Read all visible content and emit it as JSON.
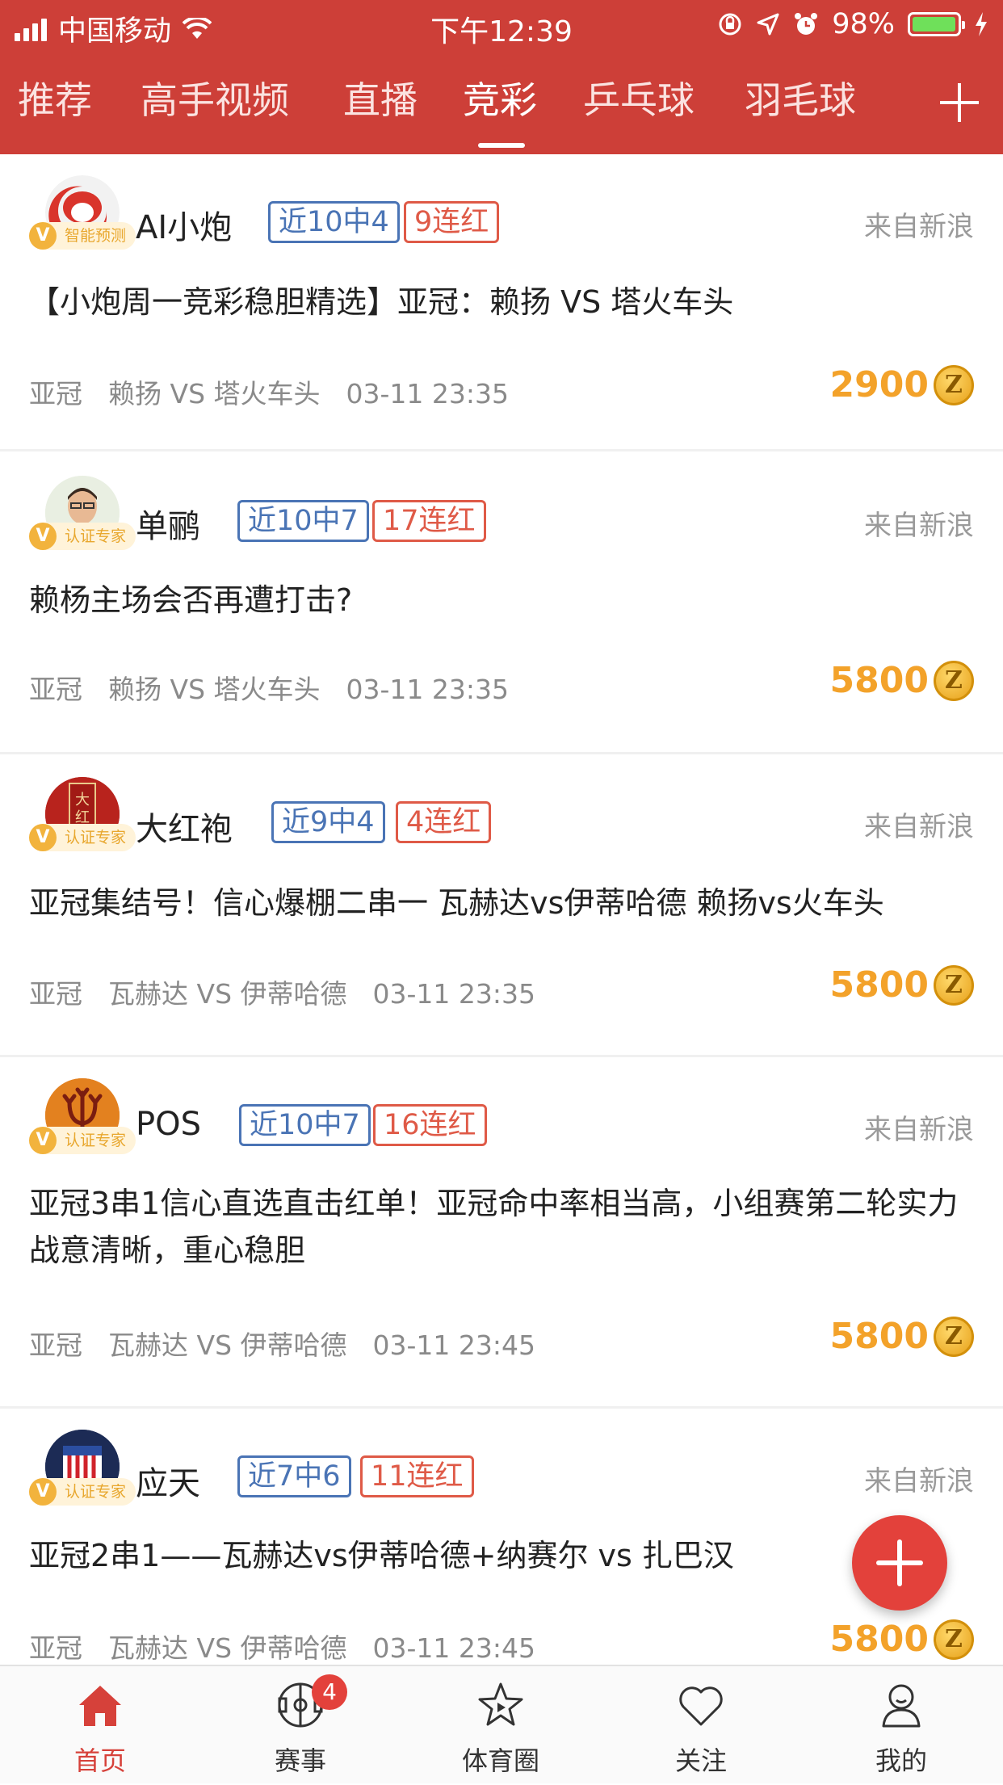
{
  "status_bar": {
    "carrier": "中国移动",
    "time": "下午12:39",
    "battery": "98%",
    "battery_level": 0.98
  },
  "nav_tabs": [
    {
      "label": "推荐",
      "active": false
    },
    {
      "label": "高手视频",
      "active": false
    },
    {
      "label": "直播",
      "active": false
    },
    {
      "label": "竞彩",
      "active": true
    },
    {
      "label": "乒乓球",
      "active": false
    },
    {
      "label": "羽毛球",
      "active": false
    }
  ],
  "posts": [
    {
      "author": "AI小炮",
      "badge": "智能预测",
      "record": "近10中4",
      "streak": "9连红",
      "source": "来自新浪",
      "title": "【小炮周一竞彩稳胆精选】亚冠：赖扬 VS 塔火车头",
      "league": "亚冠",
      "match": "赖扬 VS 塔火车头",
      "time": "03-11 23:35",
      "price": "2900"
    },
    {
      "author": "单鹂",
      "badge": "认证专家",
      "record": "近10中7",
      "streak": "17连红",
      "source": "来自新浪",
      "title": "赖杨主场会否再遭打击?",
      "league": "亚冠",
      "match": "赖扬 VS 塔火车头",
      "time": "03-11 23:35",
      "price": "5800"
    },
    {
      "author": "大红袍",
      "badge": "认证专家",
      "record": "近9中4",
      "streak": "4连红",
      "source": "来自新浪",
      "title": "亚冠集结号！信心爆棚二串一 瓦赫达vs伊蒂哈德 赖扬vs火车头",
      "league": "亚冠",
      "match": "瓦赫达 VS 伊蒂哈德",
      "time": "03-11 23:35",
      "price": "5800"
    },
    {
      "author": "POS",
      "badge": "认证专家",
      "record": "近10中7",
      "streak": "16连红",
      "source": "来自新浪",
      "title": "亚冠3串1信心直选直击红单！亚冠命中率相当高，小组赛第二轮实力战意清晰，重心稳胆",
      "league": "亚冠",
      "match": "瓦赫达 VS 伊蒂哈德",
      "time": "03-11 23:45",
      "price": "5800"
    },
    {
      "author": "应天",
      "badge": "认证专家",
      "record": "近7中6",
      "streak": "11连红",
      "source": "来自新浪",
      "title": "亚冠2串1——瓦赫达vs伊蒂哈德+纳赛尔 vs 扎巴汉",
      "league": "亚冠",
      "match": "瓦赫达 VS 伊蒂哈德",
      "time": "03-11 23:45",
      "price": "5800"
    }
  ],
  "coin_symbol": "Z",
  "bottom_tabs": [
    {
      "label": "首页",
      "icon": "home-icon",
      "active": true
    },
    {
      "label": "赛事",
      "icon": "football-field-icon",
      "active": false,
      "badge": "4"
    },
    {
      "label": "体育圈",
      "icon": "star-play-icon",
      "active": false
    },
    {
      "label": "关注",
      "icon": "heart-icon",
      "active": false
    },
    {
      "label": "我的",
      "icon": "person-icon",
      "active": false
    }
  ],
  "colors": {
    "header": "#cd3f38",
    "record_tag": "#4a74b5",
    "streak_tag": "#df5a47",
    "price": "#f3a22a",
    "active_tab": "#d6413a"
  }
}
